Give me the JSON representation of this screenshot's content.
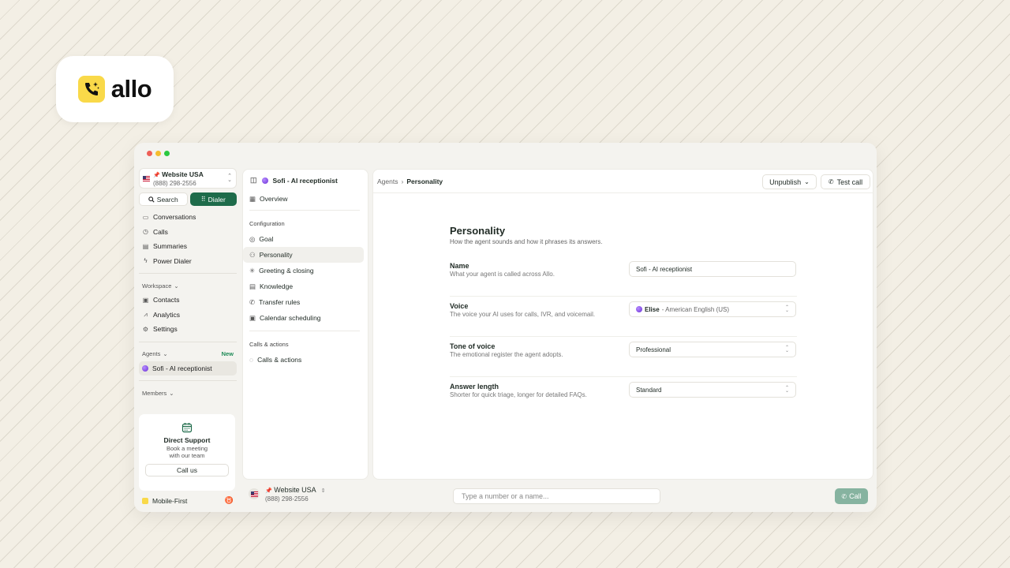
{
  "brand": {
    "name": "allo",
    "logo_icon": "phone-sparkle-icon",
    "accent": "#f9d949"
  },
  "window": {
    "dots": [
      "#ee5f57",
      "#f5bd2e",
      "#2bc840"
    ]
  },
  "sidebar": {
    "workspace": {
      "name": "Website USA",
      "number": "(888) 298-2556"
    },
    "search_label": "Search",
    "dialer_label": "Dialer",
    "nav": [
      {
        "label": "Conversations",
        "icon": "inbox-icon"
      },
      {
        "label": "Calls",
        "icon": "clock-icon"
      },
      {
        "label": "Summaries",
        "icon": "document-icon"
      },
      {
        "label": "Power Dialer",
        "icon": "lightning-icon"
      }
    ],
    "workspace_section": "Workspace",
    "workspace_nav": [
      {
        "label": "Contacts",
        "icon": "contacts-icon"
      },
      {
        "label": "Analytics",
        "icon": "chart-icon"
      },
      {
        "label": "Settings",
        "icon": "gear-icon"
      }
    ],
    "agents_section": "Agents",
    "agents_badge": "New",
    "agent_item": "Sofi - AI receptionist",
    "members_section": "Members",
    "support": {
      "title": "Direct Support",
      "subtitle": "Book a meeting with our team",
      "button": "Call us"
    },
    "footer_item": "Mobile-First"
  },
  "config_panel": {
    "agent_name": "Sofi - AI receptionist",
    "overview": "Overview",
    "configuration_title": "Configuration",
    "items": [
      "Goal",
      "Personality",
      "Greeting & closing",
      "Knowledge",
      "Transfer rules",
      "Calendar scheduling"
    ],
    "calls_title": "Calls & actions",
    "calls_item": "Calls & actions"
  },
  "header": {
    "crumb_parent": "Agents",
    "crumb_current": "Personality",
    "unpublish_label": "Unpublish",
    "test_call_label": "Test call"
  },
  "content": {
    "title": "Personality",
    "subtitle": "How the agent sounds and how it phrases its answers.",
    "fields": [
      {
        "label": "Name",
        "desc": "What your agent is called across Allo.",
        "value": "Sofi - AI receptionist"
      },
      {
        "label": "Voice",
        "desc": "The voice your AI uses for calls, IVR, and voicemail.",
        "value": "Elise",
        "value_extra": "- American English (US)"
      },
      {
        "label": "Tone of voice",
        "desc": "The emotional register the agent adopts.",
        "value": "Professional"
      },
      {
        "label": "Answer length",
        "desc": "Shorter for quick triage, longer for detailed FAQs.",
        "value": "Standard"
      }
    ]
  },
  "bottom_bar": {
    "line_name": "Website USA",
    "line_number": "(888) 298-2556",
    "input_placeholder": "Type a number or a name...",
    "call_label": "Call",
    "call_color": "#86b3a0"
  }
}
